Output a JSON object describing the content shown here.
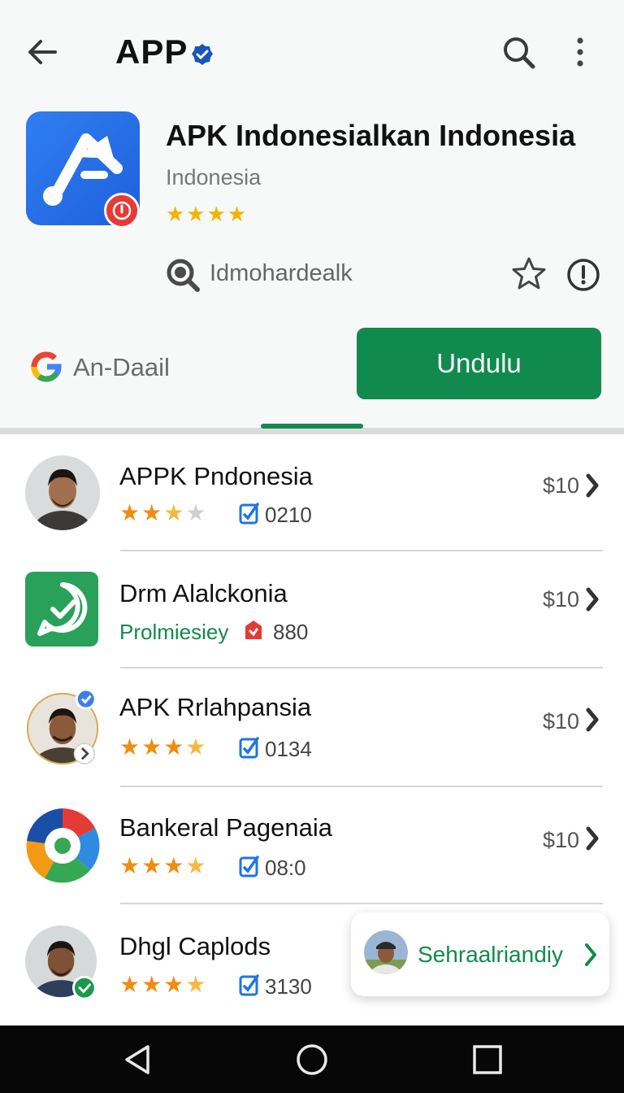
{
  "topbar": {
    "title": "APP",
    "icons": [
      "back-arrow-icon",
      "verified-badge-icon",
      "search-icon",
      "more-vert-icon"
    ]
  },
  "app": {
    "name": "APK Indonesialkan Indonesia",
    "developer": "Indonesia",
    "stars": "★★★★",
    "dev_link_text": "Idmohardealk",
    "publisher_text": "An-Daail",
    "install_label": "Undulu"
  },
  "list": [
    {
      "title": "APPK Pndonesia",
      "stars_on": 2,
      "stars_half": 1,
      "stars_off": 1,
      "count": "0210",
      "price": "$10"
    },
    {
      "title": "Drm Alalckonia",
      "subtitle": "Prolmiesiey",
      "count": "880",
      "price": "$10"
    },
    {
      "title": "APK Rrlahpansia",
      "stars_on": 3,
      "stars_half": 1,
      "stars_off": 0,
      "count": "0134",
      "price": "$10"
    },
    {
      "title": "Bankeral Pagenaia",
      "stars_on": 3,
      "stars_half": 1,
      "stars_off": 0,
      "count": "08:0",
      "price": "$10"
    },
    {
      "title": "Dhgl Caplods",
      "stars_on": 3,
      "stars_half": 1,
      "stars_off": 0,
      "count": "3130"
    }
  ],
  "toast": {
    "text": "Sehraalriandiy"
  },
  "colors": {
    "accent": "#118a4e",
    "brand_blue": "#1f5fdc",
    "star": "#f3b400"
  }
}
